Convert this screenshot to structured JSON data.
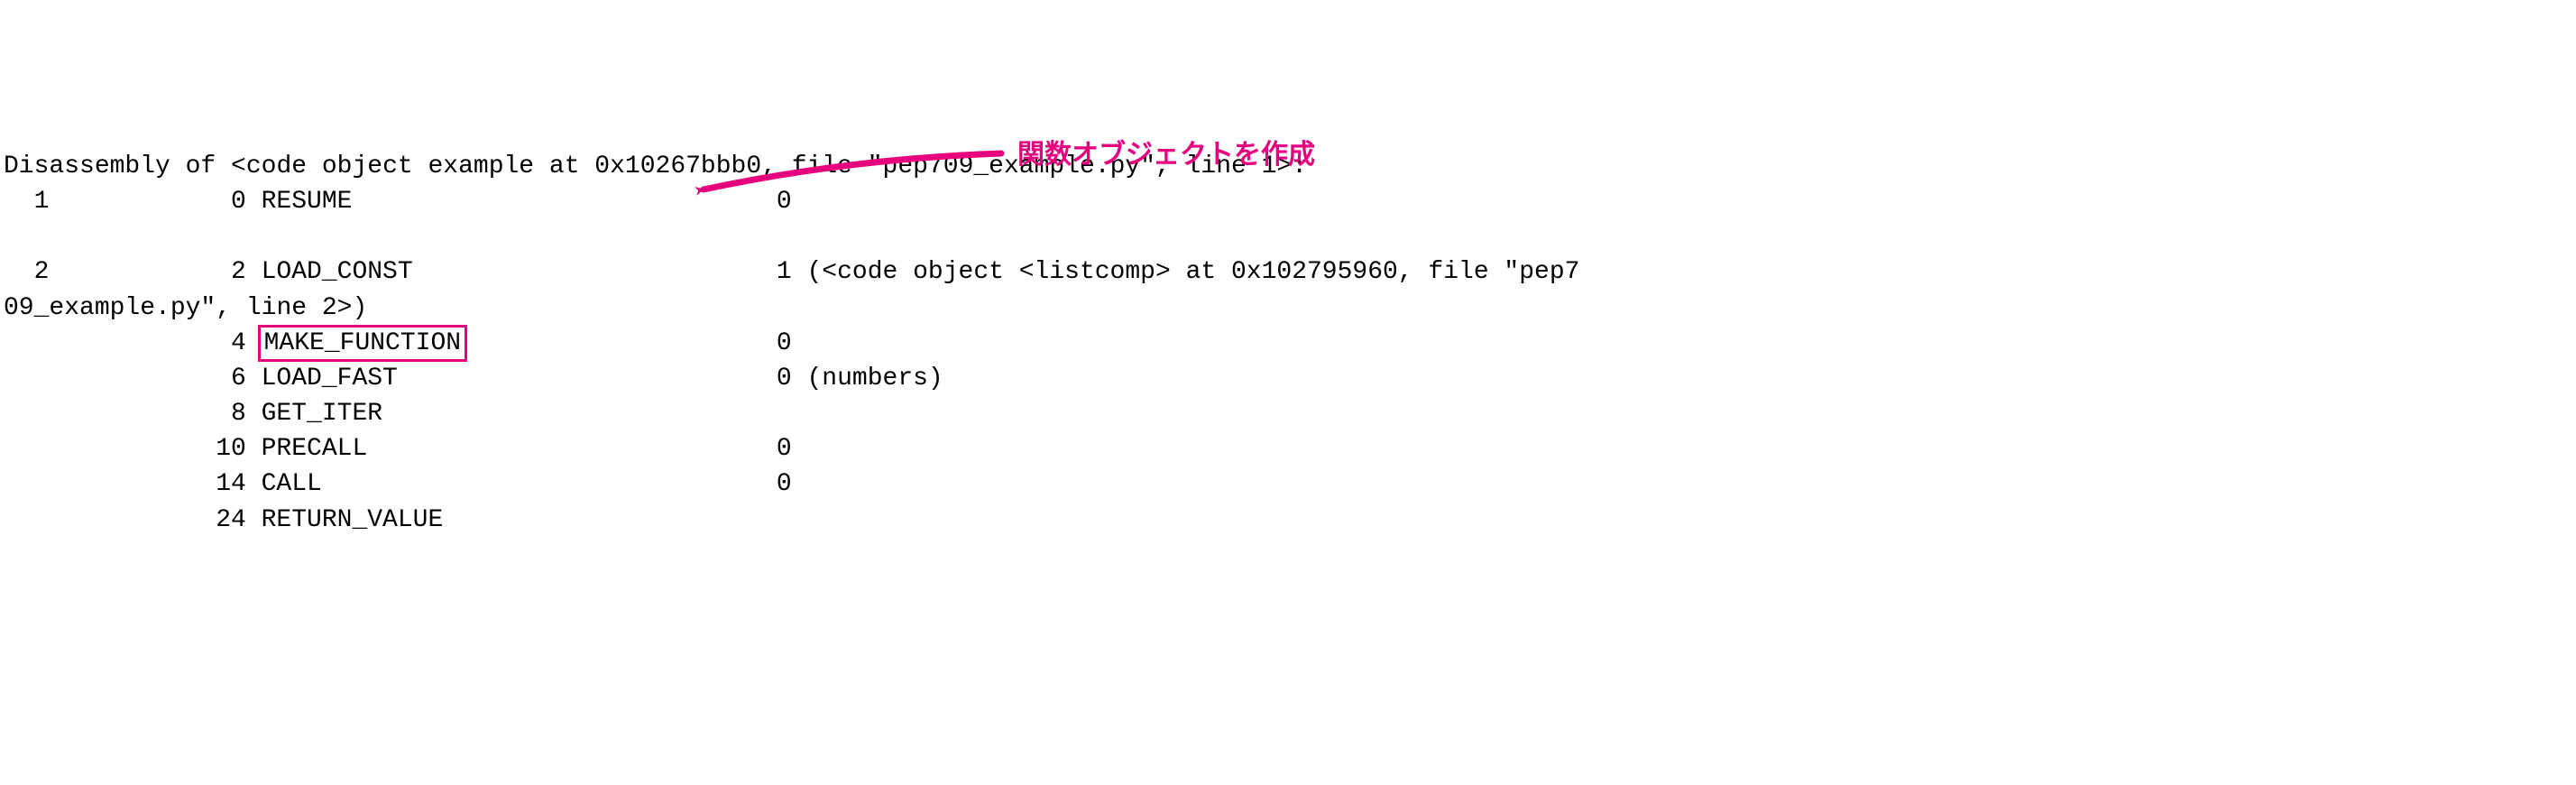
{
  "header": "Disassembly of <code object example at 0x10267bbb0, file \"pep709_example.py\", line 1>:",
  "rows": [
    {
      "line": "1",
      "offset": "0",
      "op": "RESUME",
      "arg": "0",
      "extra": "",
      "highlight": false
    },
    {
      "blank": true
    },
    {
      "line": "2",
      "offset": "2",
      "op": "LOAD_CONST",
      "arg": "1",
      "extra": "(<code object <listcomp> at 0x102795960, file \"pep7",
      "highlight": false
    },
    {
      "wrap": "09_example.py\", line 2>)"
    },
    {
      "line": "",
      "offset": "4",
      "op": "MAKE_FUNCTION",
      "arg": "0",
      "extra": "",
      "highlight": true
    },
    {
      "line": "",
      "offset": "6",
      "op": "LOAD_FAST",
      "arg": "0",
      "extra": "(numbers)",
      "highlight": false
    },
    {
      "line": "",
      "offset": "8",
      "op": "GET_ITER",
      "arg": "",
      "extra": "",
      "highlight": false
    },
    {
      "line": "",
      "offset": "10",
      "op": "PRECALL",
      "arg": "0",
      "extra": "",
      "highlight": false
    },
    {
      "line": "",
      "offset": "14",
      "op": "CALL",
      "arg": "0",
      "extra": "",
      "highlight": false
    },
    {
      "line": "",
      "offset": "24",
      "op": "RETURN_VALUE",
      "arg": "",
      "extra": "",
      "highlight": false
    }
  ],
  "annotation": {
    "label": "関数オブジェクトを作成",
    "color": "#e6007e"
  }
}
